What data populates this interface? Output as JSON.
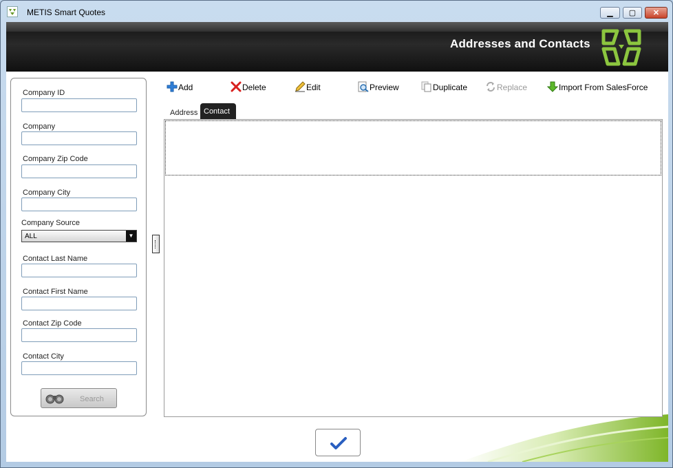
{
  "window": {
    "title": "METIS Smart Quotes",
    "controls": {
      "minimize": "▁",
      "maximize": "▢",
      "close": "✕"
    }
  },
  "header": {
    "title": "Addresses and Contacts"
  },
  "filters": {
    "company_id": {
      "label": "Company ID",
      "value": ""
    },
    "company": {
      "label": "Company",
      "value": ""
    },
    "company_zip": {
      "label": "Company Zip Code",
      "value": ""
    },
    "company_city": {
      "label": "Company City",
      "value": ""
    },
    "company_source": {
      "label": "Company Source",
      "value": "ALL"
    },
    "contact_last_name": {
      "label": "Contact Last Name",
      "value": ""
    },
    "contact_first_name": {
      "label": "Contact First Name",
      "value": ""
    },
    "contact_zip": {
      "label": "Contact Zip Code",
      "value": ""
    },
    "contact_city": {
      "label": "Contact City",
      "value": ""
    },
    "search_label": "Search"
  },
  "toolbar": {
    "add": "Add",
    "delete": "Delete",
    "edit": "Edit",
    "preview": "Preview",
    "duplicate": "Duplicate",
    "replace": "Replace",
    "import": "Import From SalesForce"
  },
  "tabs": {
    "address": "Address",
    "contact": "Contact",
    "active": "Contact"
  },
  "colors": {
    "accent_green": "#8cc63f",
    "header_dark": "#1c1c1c"
  }
}
